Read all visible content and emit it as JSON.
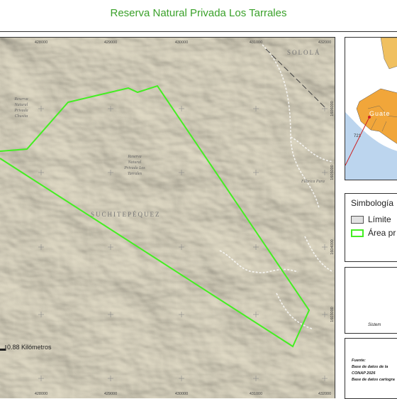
{
  "title": "Reserva Natural Privada Los Tarrales",
  "map": {
    "x_ticks": [
      "428000",
      "429000",
      "430000",
      "431000",
      "432000"
    ],
    "y_ticks": [
      "1606000",
      "1605000",
      "1604000",
      "1603000"
    ],
    "departments": [
      "SOLOLÁ",
      "SUCHITEPÉQUEZ"
    ],
    "place_fabrica": "Fábrica Para",
    "reserve_chusita": [
      "Reserva",
      "Natural",
      "Privada",
      "Chusita"
    ],
    "reserve_tarrales": [
      "Reserva",
      "Natural",
      "Privada Los",
      "Tarrales"
    ],
    "scale_label": "0.88 Kilómetros",
    "colors": {
      "boundary": "#44ee22",
      "terrain": "#ddd8c6",
      "title": "#3aa12a"
    }
  },
  "inset": {
    "label": "Guate",
    "road": "721"
  },
  "legend": {
    "title": "Simbología",
    "items": [
      {
        "label": "Límite",
        "swatch": "#e2e2e2"
      },
      {
        "label": "Área pr",
        "swatch": "#ffffff"
      }
    ]
  },
  "info": {
    "system": "Sistem"
  },
  "sources": {
    "heading": "Fuente:",
    "line1": "Base de datos de la",
    "line2": "CONAP 2026",
    "line3": "Base de datos cartogra"
  }
}
